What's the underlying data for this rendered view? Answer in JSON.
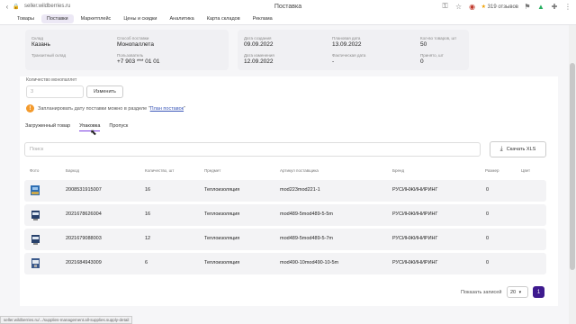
{
  "browser": {
    "url": "seller.wildberries.ru",
    "title": "Поставка",
    "reviews": "319 отзывов",
    "status_url": "seller.wildberries.ru/.../supplies-management.all-supplies.supply-detail"
  },
  "nav": {
    "tabs": [
      {
        "label": "Товары"
      },
      {
        "label": "Поставки"
      },
      {
        "label": "Маркетплейс"
      },
      {
        "label": "Цены и скидки"
      },
      {
        "label": "Аналитика"
      },
      {
        "label": "Карта складов"
      },
      {
        "label": "Реклама"
      }
    ]
  },
  "info": {
    "warehouse_label": "Склад",
    "warehouse_value": "Казань",
    "transit_label": "Транзитный склад",
    "transit_value": "",
    "method_label": "Способ поставки",
    "method_value": "Монопаллета",
    "user_label": "Пользователь",
    "user_value": "+7 903 *** 01 01",
    "created_label": "Дата создания",
    "created_value": "09.09.2022",
    "planned_label": "Плановая дата",
    "planned_value": "13.09.2022",
    "count_label": "Кол-во товаров, шт",
    "count_value": "50",
    "changed_label": "Дата изменения",
    "changed_value": "12.09.2022",
    "actual_label": "Фактическая дата",
    "actual_value": "-",
    "accepted_label": "Принято, шт",
    "accepted_value": "0"
  },
  "qty": {
    "label": "Количество монопаллет",
    "placeholder": "3",
    "change_button": "Изменить"
  },
  "notice": {
    "text": "Запланировать дату поставки можно в разделе ",
    "link": "План поставок"
  },
  "subtabs": [
    {
      "label": "Загруженный товар"
    },
    {
      "label": "Упаковка"
    },
    {
      "label": "Пропуск"
    }
  ],
  "search": {
    "placeholder": "Поиск",
    "download_button": "Скачать XLS"
  },
  "table": {
    "headers": [
      "Фото",
      "Баркод",
      "Количество, шт",
      "Предмет",
      "Артикул поставщика",
      "Бренд",
      "Размер",
      "Цвет"
    ],
    "rows": [
      {
        "barcode": "2008531915007",
        "qty": "16",
        "subject": "Теплоизоляция",
        "article": "mod223mod221-1",
        "brand": "РУСИНЖИНИРИНГ",
        "size": "0",
        "color": ""
      },
      {
        "barcode": "2021678626004",
        "qty": "16",
        "subject": "Теплоизоляция",
        "article": "mod489-5mod489-5-5m",
        "brand": "РУСИНЖИНИРИНГ",
        "size": "0",
        "color": ""
      },
      {
        "barcode": "2021679088003",
        "qty": "12",
        "subject": "Теплоизоляция",
        "article": "mod489-5mod489-5-7m",
        "brand": "РУСИНЖИНИРИНГ",
        "size": "0",
        "color": ""
      },
      {
        "barcode": "2021684943009",
        "qty": "6",
        "subject": "Теплоизоляция",
        "article": "mod490-10mod490-10-5m",
        "brand": "РУСИНЖИНИРИНГ",
        "size": "0",
        "color": ""
      }
    ]
  },
  "pager": {
    "show_label": "Показать записей",
    "per_page": "20",
    "page": "1"
  },
  "colors": {
    "accent": "#3e1a8e",
    "warning": "#f39a2c",
    "link": "#3a57b8"
  }
}
